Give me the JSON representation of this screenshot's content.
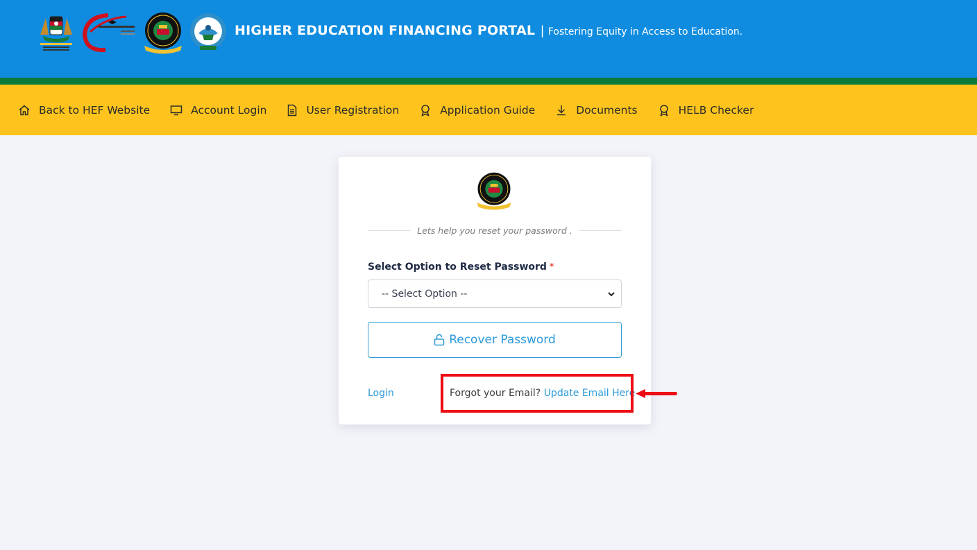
{
  "header": {
    "title": "HIGHER EDUCATION FINANCING PORTAL",
    "separator": "|",
    "tagline": "Fostering Equity in Access to Education."
  },
  "logos": [
    "kenya-coat-of-arms",
    "universities-funding-board-logo",
    "helb-logo",
    "kuccps-logo"
  ],
  "nav": {
    "items": [
      {
        "label": "Back to HEF Website",
        "icon": "home-icon"
      },
      {
        "label": "Account Login",
        "icon": "monitor-icon"
      },
      {
        "label": "User Registration",
        "icon": "document-icon"
      },
      {
        "label": "Application Guide",
        "icon": "award-icon"
      },
      {
        "label": "Documents",
        "icon": "download-icon"
      },
      {
        "label": "HELB Checker",
        "icon": "award-icon"
      }
    ]
  },
  "card": {
    "logo": "helb-logo",
    "subtitle": "Lets help you reset your password .",
    "field_label": "Select Option to Reset Password",
    "required_mark": "*",
    "select_value": "-- Select Option --",
    "button_label": "Recover Password",
    "login_link": "Login",
    "forgot_text": "Forgot your Email?",
    "update_email_link": "Update Email Here"
  },
  "colors": {
    "header_blue": "#0f8ce0",
    "stripe_green": "#0b7a3b",
    "nav_yellow": "#fec41d",
    "link_blue": "#2c9ad9",
    "annotation_red": "#ee0b14"
  }
}
